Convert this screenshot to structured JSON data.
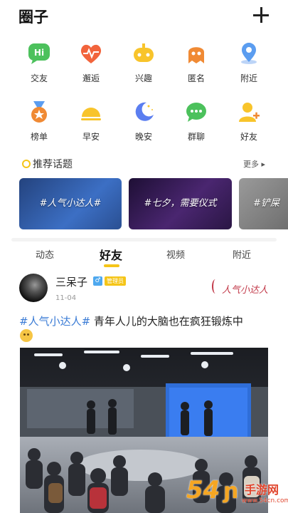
{
  "header": {
    "title": "圈子"
  },
  "grid": [
    {
      "label": "交友",
      "icon": "hi-chat-icon",
      "color": "#4cc15c"
    },
    {
      "label": "邂逅",
      "icon": "heart-pulse-icon",
      "color": "#f2643c"
    },
    {
      "label": "兴趣",
      "icon": "gamepad-icon",
      "color": "#f8c42b"
    },
    {
      "label": "匿名",
      "icon": "ghost-icon",
      "color": "#f08a34"
    },
    {
      "label": "附近",
      "icon": "location-pin-icon",
      "color": "#5b9df0"
    },
    {
      "label": "榜单",
      "icon": "medal-icon",
      "color": "#f08a34"
    },
    {
      "label": "早安",
      "icon": "sunrise-icon",
      "color": "#f8c42b"
    },
    {
      "label": "晚安",
      "icon": "moon-icon",
      "color": "#5b7ef0"
    },
    {
      "label": "群聊",
      "icon": "group-chat-icon",
      "color": "#4cc15c"
    },
    {
      "label": "好友",
      "icon": "friend-icon",
      "color": "#f8c42b"
    }
  ],
  "topics": {
    "title": "推荐话题",
    "more": "更多 ▸",
    "cards": [
      {
        "text": "#人气小达人#",
        "color": "#2f5aa8"
      },
      {
        "text": "#七夕，需要仪式",
        "color": "#3a1d55"
      },
      {
        "text": "#铲屎",
        "color": "#8a8a8a"
      }
    ]
  },
  "tabs": [
    "动态",
    "好友",
    "视频",
    "附近"
  ],
  "post": {
    "username": "三呆子",
    "gender": "♂",
    "badge": "管理员",
    "date": "11-04",
    "stamp": "人气小达人",
    "tag": "#人气小达人#",
    "text": " 青年人儿的大脑也在疯狂锻炼中"
  },
  "watermark": {
    "logo": "54",
    "suffix": "ɲ",
    "site": "手游网",
    "url": "www.54cn.com"
  }
}
